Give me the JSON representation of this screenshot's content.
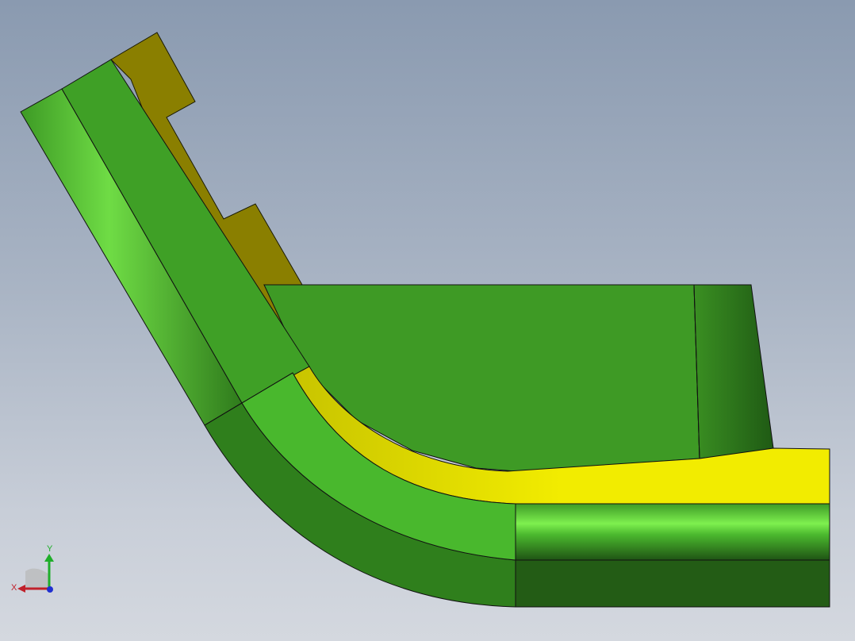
{
  "viewport": {
    "background_top": "#8a9ab0",
    "background_bottom": "#d4d8df",
    "model": {
      "face_colors": {
        "green": "#3f9d28",
        "green_dark": "#2c6e1a",
        "yellow": "#f0ea00",
        "olive": "#8a8000"
      }
    }
  },
  "triad": {
    "x_label": "X",
    "y_label": "Y",
    "x_color": "#c0202a",
    "y_color": "#1fae2a",
    "z_color": "#2030d0"
  }
}
